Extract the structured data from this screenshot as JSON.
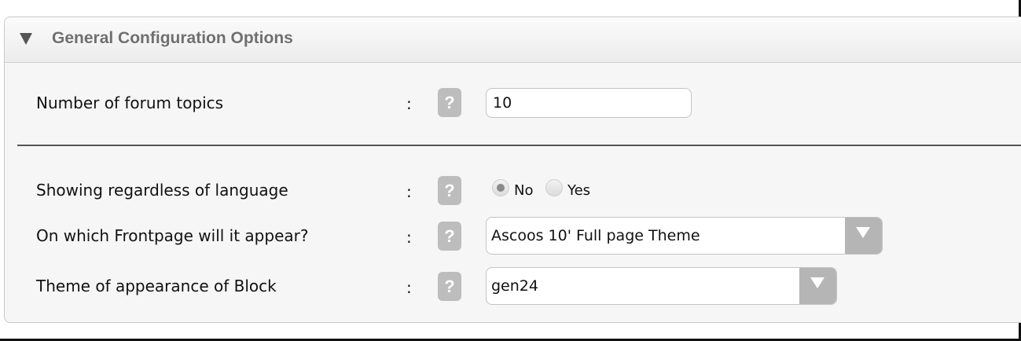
{
  "panel": {
    "title": "General Configuration Options"
  },
  "fields": {
    "forum_topics": {
      "label": "Number of forum topics",
      "colon": ":",
      "help": "?",
      "value": "10"
    },
    "regardless_language": {
      "label": "Showing regardless of language",
      "colon": ":",
      "help": "?",
      "options": [
        "No",
        "Yes"
      ],
      "selected": "No"
    },
    "frontpage": {
      "label": "On which Frontpage will it appear?",
      "colon": ":",
      "help": "?",
      "selected": "Ascoos 10' Full page Theme"
    },
    "block_theme": {
      "label": "Theme of appearance of Block",
      "colon": ":",
      "help": "?",
      "selected": "gen24"
    }
  },
  "icons": {
    "collapse": "triangle-down-icon",
    "help": "question-mark-icon",
    "dropdown": "chevron-down-icon"
  },
  "colors": {
    "header_text": "#6f6f6f",
    "help_bg": "#bdbdbd",
    "dropdown_arrow_bg": "#b5b5b5",
    "panel_bg": "#f6f6f6"
  }
}
